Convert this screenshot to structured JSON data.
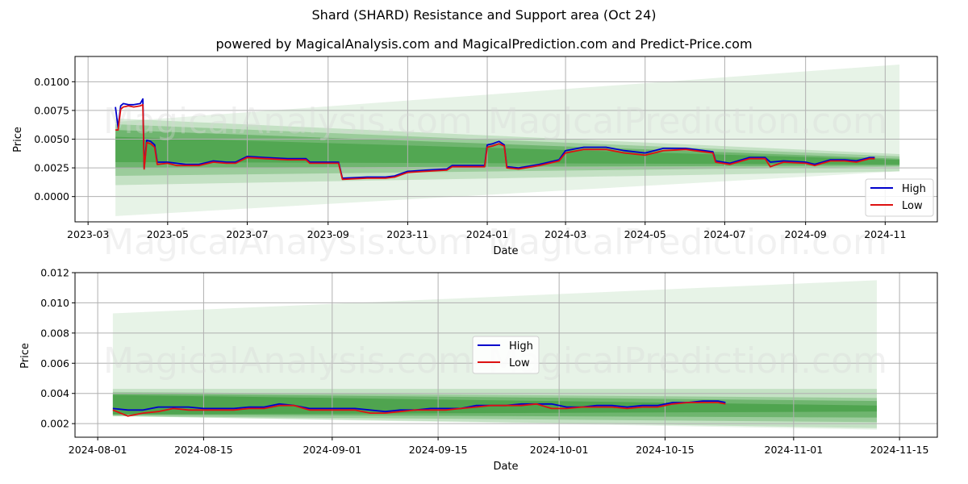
{
  "title": "Shard (SHARD) Resistance and Support area (Oct 24)",
  "subtitle": "powered by MagicalAnalysis.com and MagicalPrediction.com and Predict-Price.com",
  "watermarks": [
    "MagicalAnalysis.com",
    "MagicalPrediction.com"
  ],
  "colors": {
    "high": "#0000cc",
    "low": "#dd1111",
    "band": "#3a9a3a"
  },
  "chart_data": [
    {
      "type": "line",
      "name": "full-history",
      "title": "Shard (SHARD) Resistance and Support area (Oct 24)",
      "xlabel": "Date",
      "ylabel": "Price",
      "x_ticks": [
        "2023-03",
        "2023-05",
        "2023-07",
        "2023-09",
        "2023-11",
        "2024-01",
        "2024-03",
        "2024-05",
        "2024-07",
        "2024-09",
        "2024-11"
      ],
      "y_ticks": [
        "0.0000",
        "0.0025",
        "0.0050",
        "0.0075",
        "0.0100"
      ],
      "ylim": [
        -0.0022,
        0.0122
      ],
      "xlim": [
        "2023-02-19",
        "2024-12-11"
      ],
      "grid": true,
      "legend": {
        "position": "lower-right",
        "entries": [
          "High",
          "Low"
        ]
      },
      "series": [
        {
          "name": "High",
          "x": [
            "2023-03-22",
            "2023-03-24",
            "2023-03-26",
            "2023-03-28",
            "2023-04-01",
            "2023-04-05",
            "2023-04-10",
            "2023-04-12",
            "2023-04-13",
            "2023-04-15",
            "2023-04-18",
            "2023-04-21",
            "2023-04-23",
            "2023-05-01",
            "2023-05-08",
            "2023-05-15",
            "2023-05-25",
            "2023-06-05",
            "2023-06-15",
            "2023-06-22",
            "2023-07-01",
            "2023-07-15",
            "2023-08-01",
            "2023-08-15",
            "2023-08-18",
            "2023-09-01",
            "2023-09-09",
            "2023-09-12",
            "2023-10-01",
            "2023-10-15",
            "2023-10-22",
            "2023-11-01",
            "2023-11-15",
            "2023-12-01",
            "2023-12-05",
            "2023-12-20",
            "2023-12-30",
            "2024-01-01",
            "2024-01-05",
            "2024-01-10",
            "2024-01-14",
            "2024-01-16",
            "2024-01-25",
            "2024-02-10",
            "2024-02-25",
            "2024-03-01",
            "2024-03-15",
            "2024-04-01",
            "2024-04-15",
            "2024-05-01",
            "2024-05-15",
            "2024-06-01",
            "2024-06-15",
            "2024-06-22",
            "2024-06-24",
            "2024-07-05",
            "2024-07-20",
            "2024-08-01",
            "2024-08-05",
            "2024-08-15",
            "2024-09-01",
            "2024-09-08",
            "2024-09-20",
            "2024-10-01",
            "2024-10-10",
            "2024-10-20",
            "2024-10-24"
          ],
          "values": [
            0.0078,
            0.006,
            0.0079,
            0.0081,
            0.008,
            0.008,
            0.0081,
            0.0085,
            0.0025,
            0.0049,
            0.0048,
            0.0045,
            0.003,
            0.003,
            0.0029,
            0.0028,
            0.0028,
            0.0031,
            0.003,
            0.003,
            0.0035,
            0.0034,
            0.0033,
            0.0033,
            0.003,
            0.003,
            0.003,
            0.0016,
            0.0017,
            0.0017,
            0.0018,
            0.0022,
            0.0023,
            0.0024,
            0.0027,
            0.0027,
            0.0027,
            0.0045,
            0.0046,
            0.0048,
            0.0045,
            0.0026,
            0.0025,
            0.0028,
            0.0032,
            0.004,
            0.0043,
            0.0043,
            0.004,
            0.0038,
            0.0042,
            0.0042,
            0.004,
            0.0039,
            0.0031,
            0.0029,
            0.0034,
            0.0034,
            0.003,
            0.0031,
            0.003,
            0.0028,
            0.0032,
            0.0032,
            0.0031,
            0.0034,
            0.0034
          ]
        },
        {
          "name": "Low",
          "x": [
            "2023-03-22",
            "2023-03-24",
            "2023-03-26",
            "2023-03-28",
            "2023-04-01",
            "2023-04-05",
            "2023-04-10",
            "2023-04-12",
            "2023-04-13",
            "2023-04-15",
            "2023-04-18",
            "2023-04-21",
            "2023-04-23",
            "2023-05-01",
            "2023-05-08",
            "2023-05-15",
            "2023-05-25",
            "2023-06-05",
            "2023-06-15",
            "2023-06-22",
            "2023-07-01",
            "2023-07-15",
            "2023-08-01",
            "2023-08-15",
            "2023-08-18",
            "2023-09-01",
            "2023-09-09",
            "2023-09-12",
            "2023-10-01",
            "2023-10-15",
            "2023-10-22",
            "2023-11-01",
            "2023-11-15",
            "2023-12-01",
            "2023-12-05",
            "2023-12-20",
            "2023-12-30",
            "2024-01-01",
            "2024-01-05",
            "2024-01-10",
            "2024-01-14",
            "2024-01-16",
            "2024-01-25",
            "2024-02-10",
            "2024-02-25",
            "2024-03-01",
            "2024-03-15",
            "2024-04-01",
            "2024-04-15",
            "2024-05-01",
            "2024-05-15",
            "2024-06-01",
            "2024-06-15",
            "2024-06-22",
            "2024-06-24",
            "2024-07-05",
            "2024-07-20",
            "2024-08-01",
            "2024-08-05",
            "2024-08-15",
            "2024-09-01",
            "2024-09-08",
            "2024-09-20",
            "2024-10-01",
            "2024-10-10",
            "2024-10-20",
            "2024-10-24"
          ],
          "values": [
            0.0058,
            0.0058,
            0.0076,
            0.0078,
            0.0079,
            0.0078,
            0.0079,
            0.008,
            0.0024,
            0.0047,
            0.0046,
            0.0043,
            0.0028,
            0.0029,
            0.0027,
            0.0027,
            0.0027,
            0.003,
            0.0029,
            0.0029,
            0.0034,
            0.0033,
            0.0032,
            0.0032,
            0.0029,
            0.0029,
            0.0029,
            0.0015,
            0.0016,
            0.0016,
            0.0017,
            0.0021,
            0.0022,
            0.0023,
            0.0026,
            0.0026,
            0.0026,
            0.0043,
            0.0044,
            0.0046,
            0.0044,
            0.0025,
            0.0024,
            0.0027,
            0.0031,
            0.0038,
            0.0041,
            0.0041,
            0.0038,
            0.0036,
            0.004,
            0.0041,
            0.0039,
            0.0038,
            0.003,
            0.0028,
            0.0033,
            0.0033,
            0.0026,
            0.003,
            0.0029,
            0.0027,
            0.0031,
            0.0031,
            0.003,
            0.0033,
            0.0033
          ]
        }
      ],
      "bands": {
        "x": [
          "2023-03-22",
          "2024-11-12"
        ],
        "layers": [
          {
            "upper": [
              0.0065,
              0.0115
            ],
            "lower": [
              -0.0017,
              0.0022
            ],
            "opacity": 0.12
          },
          {
            "upper": [
              0.0068,
              0.0037
            ],
            "lower": [
              0.001,
              0.0022
            ],
            "opacity": 0.2
          },
          {
            "upper": [
              0.0063,
              0.0035
            ],
            "lower": [
              0.0018,
              0.0026
            ],
            "opacity": 0.3
          },
          {
            "upper": [
              0.0058,
              0.0033
            ],
            "lower": [
              0.0025,
              0.0027
            ],
            "opacity": 0.45
          },
          {
            "upper": [
              0.0052,
              0.0032
            ],
            "lower": [
              0.003,
              0.0028
            ],
            "opacity": 0.55
          }
        ]
      }
    },
    {
      "type": "line",
      "name": "recent-zoom",
      "xlabel": "Date",
      "ylabel": "Price",
      "x_ticks": [
        "2024-08-01",
        "2024-08-15",
        "2024-09-01",
        "2024-09-15",
        "2024-10-01",
        "2024-10-15",
        "2024-11-01",
        "2024-11-15"
      ],
      "y_ticks": [
        "0.002",
        "0.004",
        "0.006",
        "0.008",
        "0.010",
        "0.012"
      ],
      "ylim": [
        0.0011,
        0.012
      ],
      "xlim": [
        "2024-07-29",
        "2024-11-20"
      ],
      "grid": true,
      "legend": {
        "position": "center",
        "entries": [
          "High",
          "Low"
        ]
      },
      "series": [
        {
          "name": "High",
          "x": [
            "2024-08-03",
            "2024-08-05",
            "2024-08-07",
            "2024-08-09",
            "2024-08-11",
            "2024-08-13",
            "2024-08-15",
            "2024-08-17",
            "2024-08-19",
            "2024-08-21",
            "2024-08-23",
            "2024-08-25",
            "2024-08-27",
            "2024-08-29",
            "2024-08-31",
            "2024-09-02",
            "2024-09-04",
            "2024-09-06",
            "2024-09-08",
            "2024-09-10",
            "2024-09-12",
            "2024-09-14",
            "2024-09-16",
            "2024-09-18",
            "2024-09-20",
            "2024-09-22",
            "2024-09-24",
            "2024-09-26",
            "2024-09-28",
            "2024-09-30",
            "2024-10-02",
            "2024-10-04",
            "2024-10-06",
            "2024-10-08",
            "2024-10-10",
            "2024-10-12",
            "2024-10-14",
            "2024-10-16",
            "2024-10-18",
            "2024-10-20",
            "2024-10-22",
            "2024-10-23"
          ],
          "values": [
            0.003,
            0.0029,
            0.0029,
            0.0031,
            0.0031,
            0.0031,
            0.003,
            0.003,
            0.003,
            0.0031,
            0.0031,
            0.0033,
            0.0032,
            0.003,
            0.003,
            0.003,
            0.003,
            0.0029,
            0.0028,
            0.0029,
            0.0029,
            0.003,
            0.003,
            0.003,
            0.0032,
            0.0032,
            0.0032,
            0.0033,
            0.0033,
            0.0033,
            0.0031,
            0.0031,
            0.0032,
            0.0032,
            0.0031,
            0.0032,
            0.0032,
            0.0034,
            0.0034,
            0.0035,
            0.0035,
            0.0034
          ]
        },
        {
          "name": "Low",
          "x": [
            "2024-08-03",
            "2024-08-05",
            "2024-08-07",
            "2024-08-09",
            "2024-08-11",
            "2024-08-13",
            "2024-08-15",
            "2024-08-17",
            "2024-08-19",
            "2024-08-21",
            "2024-08-23",
            "2024-08-25",
            "2024-08-27",
            "2024-08-29",
            "2024-08-31",
            "2024-09-02",
            "2024-09-04",
            "2024-09-06",
            "2024-09-08",
            "2024-09-10",
            "2024-09-12",
            "2024-09-14",
            "2024-09-16",
            "2024-09-18",
            "2024-09-20",
            "2024-09-22",
            "2024-09-24",
            "2024-09-26",
            "2024-09-28",
            "2024-09-30",
            "2024-10-02",
            "2024-10-04",
            "2024-10-06",
            "2024-10-08",
            "2024-10-10",
            "2024-10-12",
            "2024-10-14",
            "2024-10-16",
            "2024-10-18",
            "2024-10-20",
            "2024-10-22",
            "2024-10-23"
          ],
          "values": [
            0.0029,
            0.0025,
            0.0027,
            0.0028,
            0.003,
            0.0029,
            0.0029,
            0.0029,
            0.0029,
            0.003,
            0.003,
            0.0032,
            0.0032,
            0.0029,
            0.0029,
            0.0029,
            0.0029,
            0.0027,
            0.0027,
            0.0028,
            0.0029,
            0.0029,
            0.0029,
            0.003,
            0.0031,
            0.0032,
            0.0032,
            0.0032,
            0.0033,
            0.003,
            0.003,
            0.0031,
            0.0031,
            0.0031,
            0.003,
            0.0031,
            0.0031,
            0.0033,
            0.0034,
            0.0034,
            0.0034,
            0.0033
          ]
        }
      ],
      "bands": {
        "x": [
          "2024-08-03",
          "2024-11-12"
        ],
        "layers": [
          {
            "upper": [
              0.0093,
              0.0115
            ],
            "lower": [
              0.0025,
              0.0016
            ],
            "opacity": 0.12
          },
          {
            "upper": [
              0.0043,
              0.0043
            ],
            "lower": [
              0.0025,
              0.0017
            ],
            "opacity": 0.2
          },
          {
            "upper": [
              0.0041,
              0.0037
            ],
            "lower": [
              0.0025,
              0.0021
            ],
            "opacity": 0.3
          },
          {
            "upper": [
              0.004,
              0.0035
            ],
            "lower": [
              0.0026,
              0.0024
            ],
            "opacity": 0.45
          },
          {
            "upper": [
              0.0039,
              0.0032
            ],
            "lower": [
              0.0026,
              0.0028
            ],
            "opacity": 0.6
          }
        ]
      }
    }
  ]
}
